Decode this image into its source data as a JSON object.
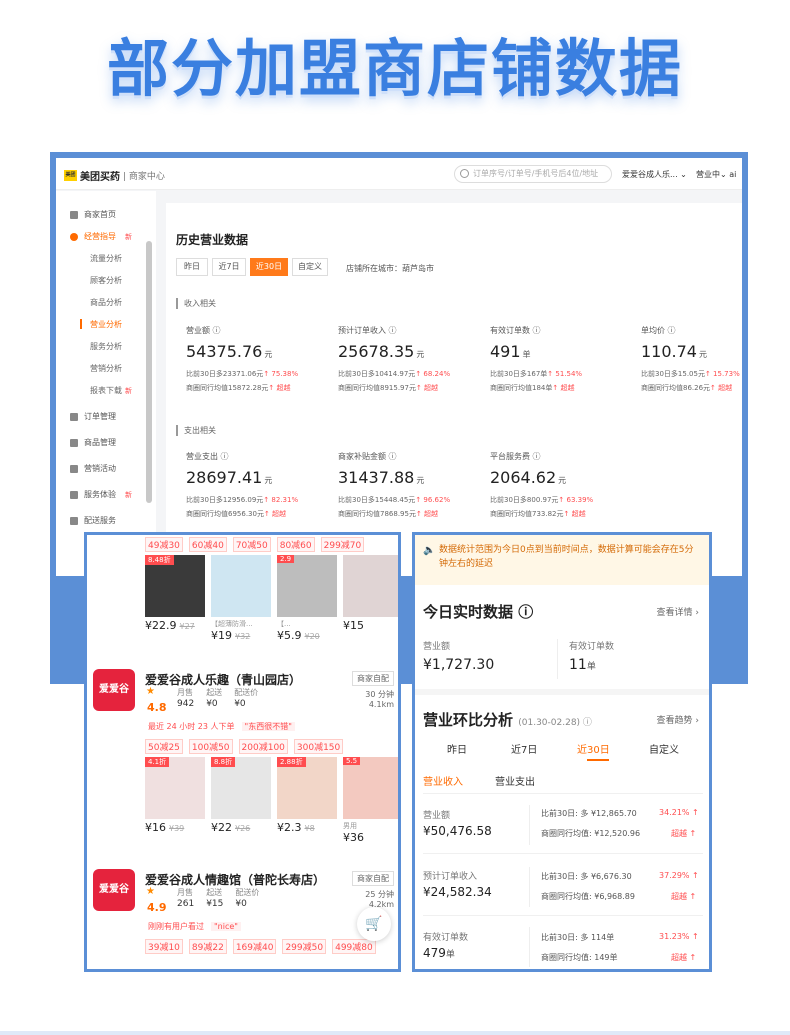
{
  "page_title": "部分加盟商店铺数据",
  "desk": {
    "logo_mark": "美团",
    "logo_text": "美团买药",
    "logo_sub": "| 商家中心",
    "search_placeholder": "订单序号/订单号/手机号后4位/地址",
    "store_name": "爱爱谷成人乐... ⌄",
    "status": "营业中⌄  ai",
    "sidebar": {
      "items": [
        {
          "label": "商家首页"
        },
        {
          "label": "经营指导",
          "badge": "新"
        },
        {
          "label": "订单管理"
        },
        {
          "label": "商品管理"
        },
        {
          "label": "营销活动"
        },
        {
          "label": "服务体验",
          "badge": "新"
        },
        {
          "label": "配送服务"
        }
      ],
      "subitems": [
        {
          "label": "流量分析"
        },
        {
          "label": "顾客分析"
        },
        {
          "label": "商品分析"
        },
        {
          "label": "营业分析"
        },
        {
          "label": "服务分析"
        },
        {
          "label": "营销分析"
        },
        {
          "label": "报表下载",
          "badge": "新"
        }
      ]
    },
    "panel": {
      "title": "历史营业数据",
      "segments": [
        "昨日",
        "近7日",
        "近30日",
        "自定义"
      ],
      "city": "店铺所在城市：葫芦岛市",
      "income_label": "收入相关",
      "expense_label": "支出相关",
      "income_metrics": [
        {
          "label": "营业额 ⓘ",
          "value": "54375.76",
          "unit": "元",
          "compare": "比前30日多23371.06元",
          "pct": "↑ 75.38%",
          "peer": "商圈同行均值15872.28元",
          "peer_tag": "↑ 超越"
        },
        {
          "label": "预计订单收入 ⓘ",
          "value": "25678.35",
          "unit": "元",
          "compare": "比前30日多10414.97元",
          "pct": "↑ 68.24%",
          "peer": "商圈同行均值8915.97元",
          "peer_tag": "↑ 超越"
        },
        {
          "label": "有效订单数 ⓘ",
          "value": "491",
          "unit": "单",
          "compare": "比前30日多167单",
          "pct": "↑ 51.54%",
          "peer": "商圈同行均值184单",
          "peer_tag": "↑ 超越"
        },
        {
          "label": "单均价 ⓘ",
          "value": "110.74",
          "unit": "元",
          "compare": "比前30日多15.05元",
          "pct": "↑ 15.73%",
          "peer": "商圈同行均值86.26元",
          "peer_tag": "↑ 超越"
        }
      ],
      "expense_metrics": [
        {
          "label": "营业支出 ⓘ",
          "value": "28697.41",
          "unit": "元",
          "compare": "比前30日多12956.09元",
          "pct": "↑ 82.31%",
          "peer": "商圈同行均值6956.30元",
          "peer_tag": "↑ 超越"
        },
        {
          "label": "商家补贴金额 ⓘ",
          "value": "31437.88",
          "unit": "元",
          "compare": "比前30日多15448.45元",
          "pct": "↑ 96.62%",
          "peer": "商圈同行均值7868.95元",
          "peer_tag": "↑ 超越"
        },
        {
          "label": "平台服务费 ⓘ",
          "value": "2064.62",
          "unit": "元",
          "compare": "比前30日多800.97元",
          "pct": "↑ 63.39%",
          "peer": "商圈同行均值733.82元",
          "peer_tag": "↑ 超越"
        }
      ]
    }
  },
  "shops": {
    "top_promos": [
      "49减30",
      "60减40",
      "70减50",
      "80减60",
      "299减70"
    ],
    "top_products": [
      {
        "tag": "8.48折",
        "name": "",
        "price": "¥22.9",
        "orig": "¥27"
      },
      {
        "tag": "",
        "name": "【超薄防滑...",
        "price": "¥19",
        "orig": "¥32"
      },
      {
        "tag": "2.9",
        "name": "【...",
        "price": "¥5.9",
        "orig": "¥20"
      },
      {
        "tag": "",
        "name": "",
        "price": "¥15",
        "orig": ""
      }
    ],
    "shop1": {
      "logo": "爱爱谷",
      "name": "爱爱谷成人乐趣（青山园店）",
      "badge": "商家自配",
      "rating": "4.8",
      "sales_label": "月售",
      "sales": "942",
      "min_label": "起送",
      "min": "¥0",
      "fee_label": "配送价",
      "fee": "¥0",
      "time": "30 分钟",
      "dist": "4.1km",
      "note": "最近 24 小时 23 人下单",
      "note_tag": "\"东西很不错\"",
      "promos": [
        "50减25",
        "100减50",
        "200减100",
        "300减150"
      ],
      "products": [
        {
          "tag": "4.1折",
          "name": "",
          "price": "¥16",
          "orig": "¥39"
        },
        {
          "tag": "8.8折",
          "name": "",
          "price": "¥22",
          "orig": "¥26"
        },
        {
          "tag": "2.88折",
          "name": "",
          "price": "¥2.3",
          "orig": "¥8"
        },
        {
          "tag": "5.5",
          "name": "男用",
          "price": "¥36",
          "orig": ""
        }
      ]
    },
    "shop2": {
      "logo": "爱爱谷",
      "name": "爱爱谷成人情趣馆（普陀长寿店）",
      "badge": "商家自配",
      "rating": "4.9",
      "sales_label": "月售",
      "sales": "261",
      "min_label": "起送",
      "min": "¥15",
      "fee_label": "配送价",
      "fee": "¥0",
      "time": "25 分钟",
      "dist": "4.2km",
      "note": "刚刚有用户看过",
      "note_tag": "\"nice\"",
      "promos": [
        "39减10",
        "89减22",
        "169减40",
        "299减50",
        "499减80"
      ]
    },
    "cart_icon": "cart-icon"
  },
  "realtime": {
    "notice": "数据统计范围为今日0点到当前时间点，数据计算可能会存在5分钟左右的延迟",
    "today_title": "今日实时数据 ⓘ",
    "today_link": "查看详情 ›",
    "revenue_label": "营业额",
    "revenue_value": "¥1,727.30",
    "orders_label": "有效订单数",
    "orders_value": "11",
    "orders_unit": "单",
    "compare_title": "营业环比分析",
    "compare_range": "(01.30-02.28) ⓘ",
    "compare_link": "查看趋势 ›",
    "tabs": [
      "昨日",
      "近7日",
      "近30日",
      "自定义"
    ],
    "subtabs": [
      "营业收入",
      "营业支出"
    ],
    "rows": [
      {
        "label": "营业额",
        "value": "¥50,476.58",
        "cmp": "比前30日: 多 ¥12,865.70",
        "pct": "34.21% ↑",
        "peer": "商圈同行均值: ¥12,520.96",
        "peer_tag": "超越 ↑"
      },
      {
        "label": "预计订单收入",
        "value": "¥24,582.34",
        "cmp": "比前30日: 多 ¥6,676.30",
        "pct": "37.29% ↑",
        "peer": "商圈同行均值: ¥6,968.89",
        "peer_tag": "超越 ↑"
      },
      {
        "label": "有效订单数",
        "value": "479",
        "unit": "单",
        "cmp": "比前30日: 多 114单",
        "pct": "31.23% ↑",
        "peer": "商圈同行均值: 149单",
        "peer_tag": "超越 ↑"
      }
    ]
  }
}
